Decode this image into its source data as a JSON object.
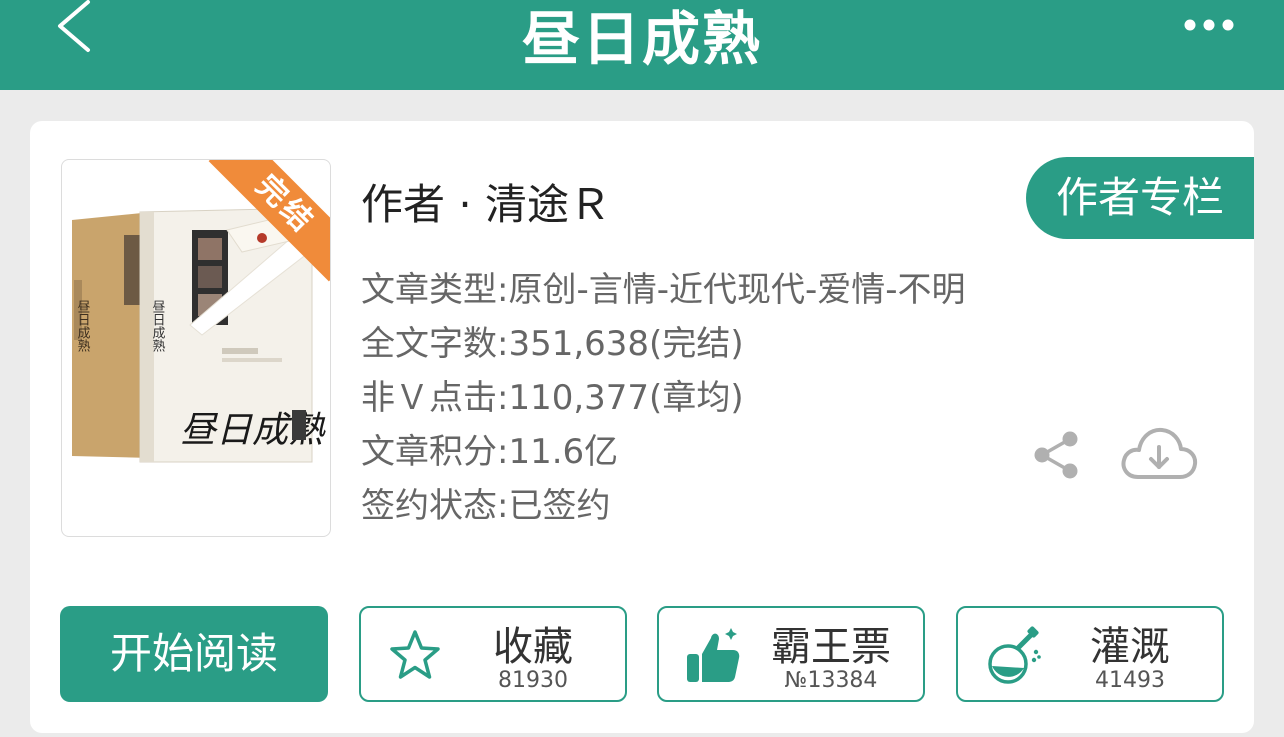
{
  "header": {
    "title": "昼日成熟",
    "back_icon": "chevron-left-icon",
    "more_icon": "more-horizontal-icon"
  },
  "book": {
    "status_ribbon": "完结",
    "cover_title": "昼日成熟",
    "author": "作者 · 清途Ｒ",
    "author_column_button": "作者专栏",
    "info": {
      "type": "文章类型:原创-言情-近代现代-爱情-不明",
      "word_count": "全文字数:351,638(完结)",
      "clicks": "非Ｖ点击:110,377(章均)",
      "score": "文章积分:11.6亿",
      "signing": "签约状态:已签约"
    }
  },
  "actions": {
    "read_label": "开始阅读",
    "favorite": {
      "label": "收藏",
      "count": "81930",
      "icon": "star-icon"
    },
    "overlord": {
      "label": "霸王票",
      "count": "№13384",
      "icon": "thumbs-up-icon"
    },
    "irrigate": {
      "label": "灌溉",
      "count": "41493",
      "icon": "flask-icon"
    }
  },
  "colors": {
    "brand": "#2a9d86",
    "ribbon": "#f08b3a",
    "background": "#ebebeb"
  }
}
